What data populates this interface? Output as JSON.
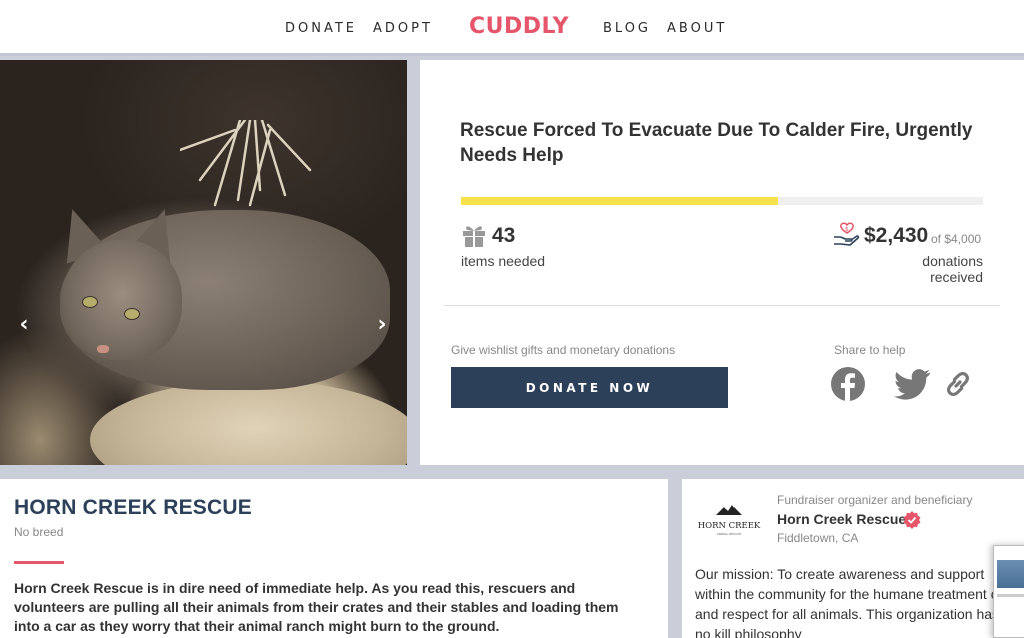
{
  "nav": {
    "left_links": [
      "DONATE",
      "ADOPT"
    ],
    "logo": "CUDDLY",
    "right_links": [
      "BLOG",
      "ABOUT"
    ]
  },
  "hero": {
    "prev_icon": "chevron-left-icon",
    "next_icon": "chevron-right-icon",
    "carousel": {
      "slides": 24,
      "active_index": 3
    }
  },
  "campaign": {
    "title": "Rescue Forced To Evacuate Due To Calder Fire, Urgently Needs Help",
    "progress_fraction": 0.6075,
    "items_count": "43",
    "items_label": "items needed",
    "donations_amount": "$2,430",
    "donations_goal": "of $4,000",
    "donations_label": "donations received",
    "give_text": "Give wishlist gifts and monetary donations",
    "donate_button": "DONATE NOW",
    "share_text": "Share to help",
    "share_icons": [
      "facebook-icon",
      "twitter-icon",
      "link-icon"
    ]
  },
  "about": {
    "name": "HORN CREEK RESCUE",
    "breed": "No breed",
    "description": "Horn Creek Rescue is in dire need of immediate help. As you read this, rescuers and volunteers are pulling all their animals from their crates and their stables and loading them into a car as they worry that their animal ranch might burn to the ground."
  },
  "organizer": {
    "role": "Fundraiser organizer and beneficiary",
    "name": "Horn Creek Rescue",
    "location": "Fiddletown,  CA",
    "logo_text": "HORN CREEK",
    "logo_subtext": "ANIMAL RESCUE",
    "mission": "Our mission: To create awareness and support within the community for the humane treatment of and respect for all animals. This organization has a no kill philosophy"
  },
  "colors": {
    "brand": "#e6566a",
    "navy": "#2c4159",
    "progress": "#f8e24b"
  }
}
